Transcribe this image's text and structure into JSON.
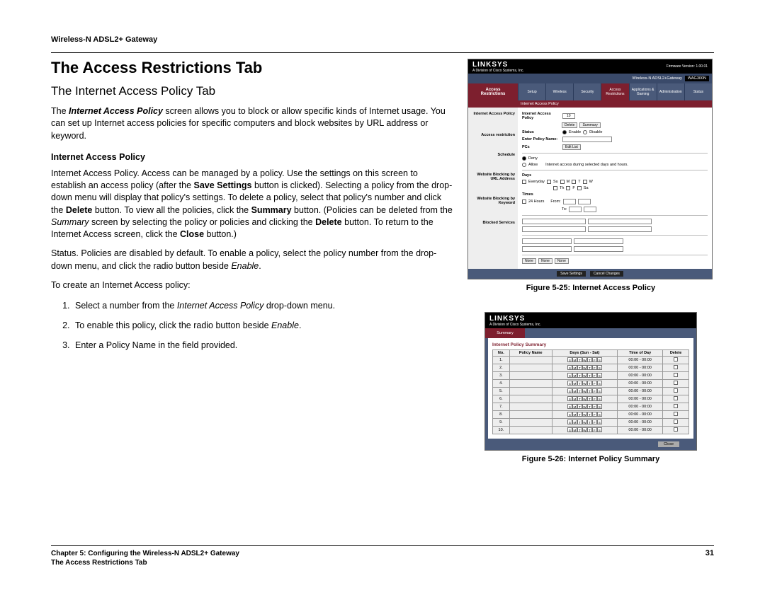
{
  "header": {
    "product": "Wireless-N ADSL2+ Gateway"
  },
  "title": "The Access Restrictions Tab",
  "subtitle": "The Internet Access Policy Tab",
  "intro": {
    "p1_prefix": "The ",
    "p1_em": "Internet Access Policy",
    "p1_suffix": " screen allows you to block or allow specific kinds of Internet usage. You can set up Internet access policies for specific computers and block websites by URL address or keyword."
  },
  "section_heading": "Internet Access Policy",
  "para_policy": {
    "a": "Internet Access Policy. Access can be managed by a policy. Use the settings on this screen to establish an access policy (after the ",
    "b_bold": "Save Settings",
    "c": " button is clicked). Selecting a policy from the drop-down menu will display that policy's settings. To delete a policy, select that policy's number and click the ",
    "d_bold": "Delete",
    "e": " button. To view all the policies, click the ",
    "f_bold": "Summary",
    "g": " button. (Policies can be deleted from the ",
    "h_em": "Summary",
    "i": " screen by selecting the policy or policies and clicking the ",
    "j_bold": "Delete",
    "k": " button. To return to the Internet Access screen, click the ",
    "l_bold": "Close",
    "m": " button.)"
  },
  "para_status": {
    "a": "Status. Policies are disabled by default. To enable a policy, select the policy number from the drop-down menu, and click the radio button beside ",
    "b_em": "Enable",
    "c": "."
  },
  "para_create": "To create an Internet Access policy:",
  "steps": {
    "s1a": "Select a number from the ",
    "s1b_em": "Internet Access Policy",
    "s1c": " drop-down menu.",
    "s2a": "To enable this policy, click the radio button beside ",
    "s2b_em": "Enable",
    "s2c": ".",
    "s3": "Enter a Policy Name in the field provided."
  },
  "fig25": {
    "caption": "Figure 5-25: Internet Access Policy",
    "brand": "LINKSYS",
    "brand_sub": "A Division of Cisco Systems, Inc.",
    "fw": "Firmware Version: 1.00.01",
    "bar_product": "Wireless-N ADSL2+Gateway",
    "bar_model": "WAG300N",
    "side_l1": "Access",
    "side_l2": "Restrictions",
    "tabs": [
      "Setup",
      "Wireless",
      "Security",
      "Access Restrictions",
      "Applications & Gaming",
      "Administration",
      "Status"
    ],
    "subnav": "Internet Access Policy",
    "labels": [
      "Internet Access Policy",
      "Access restriction",
      "Schedule",
      "Website Blocking by URL Address",
      "Website Blocking by Keyword",
      "Blocked Services"
    ],
    "form": {
      "iap": "Internet Access Policy",
      "dd_val": "10",
      "delete": "Delete",
      "summary": "Summary",
      "status": "Status",
      "enable": "Enable",
      "disable": "Disable",
      "enter_name": "Enter Policy Name:",
      "pcs": "PCs",
      "editlist": "Edit List",
      "deny": "Deny",
      "allow": "Allow",
      "deny_txt": "Internet access during selected days and hours.",
      "days": "Days",
      "everyday": "Everyday",
      "d": [
        "Su",
        "M",
        "T",
        "W",
        "Th",
        "F",
        "Sa"
      ],
      "times": "Times",
      "h24": "24 Hours",
      "from": "From:",
      "to": "To:",
      "none": "None",
      "save": "Save Settings",
      "cancel": "Cancel Changes"
    }
  },
  "fig26": {
    "caption": "Figure 5-26: Internet Policy Summary",
    "brand": "LINKSYS",
    "brand_sub": "A Division of Cisco Systems, Inc.",
    "side": "Summary",
    "heading": "Internet Policy Summary",
    "headers": [
      "No.",
      "Policy Name",
      "Days (Sun - Sat)",
      "Time of Day",
      "Delete"
    ],
    "day_letters": [
      "S",
      "M",
      "T",
      "W",
      "T",
      "F",
      "S"
    ],
    "rows": [
      {
        "n": "1.",
        "t": "00:00 - 00:00"
      },
      {
        "n": "2.",
        "t": "00:00 - 00:00"
      },
      {
        "n": "3.",
        "t": "00:00 - 00:00"
      },
      {
        "n": "4.",
        "t": "00:00 - 00:00"
      },
      {
        "n": "5.",
        "t": "00:00 - 00:00"
      },
      {
        "n": "6.",
        "t": "00:00 - 00:00"
      },
      {
        "n": "7.",
        "t": "00:00 - 00:00"
      },
      {
        "n": "8.",
        "t": "00:00 - 00:00"
      },
      {
        "n": "9.",
        "t": "00:00 - 00:00"
      },
      {
        "n": "10.",
        "t": "00:00 - 00:00"
      }
    ],
    "close": "Close"
  },
  "footer": {
    "line1": "Chapter 5: Configuring the Wireless-N ADSL2+ Gateway",
    "line2": "The Access Restrictions Tab",
    "page": "31"
  }
}
